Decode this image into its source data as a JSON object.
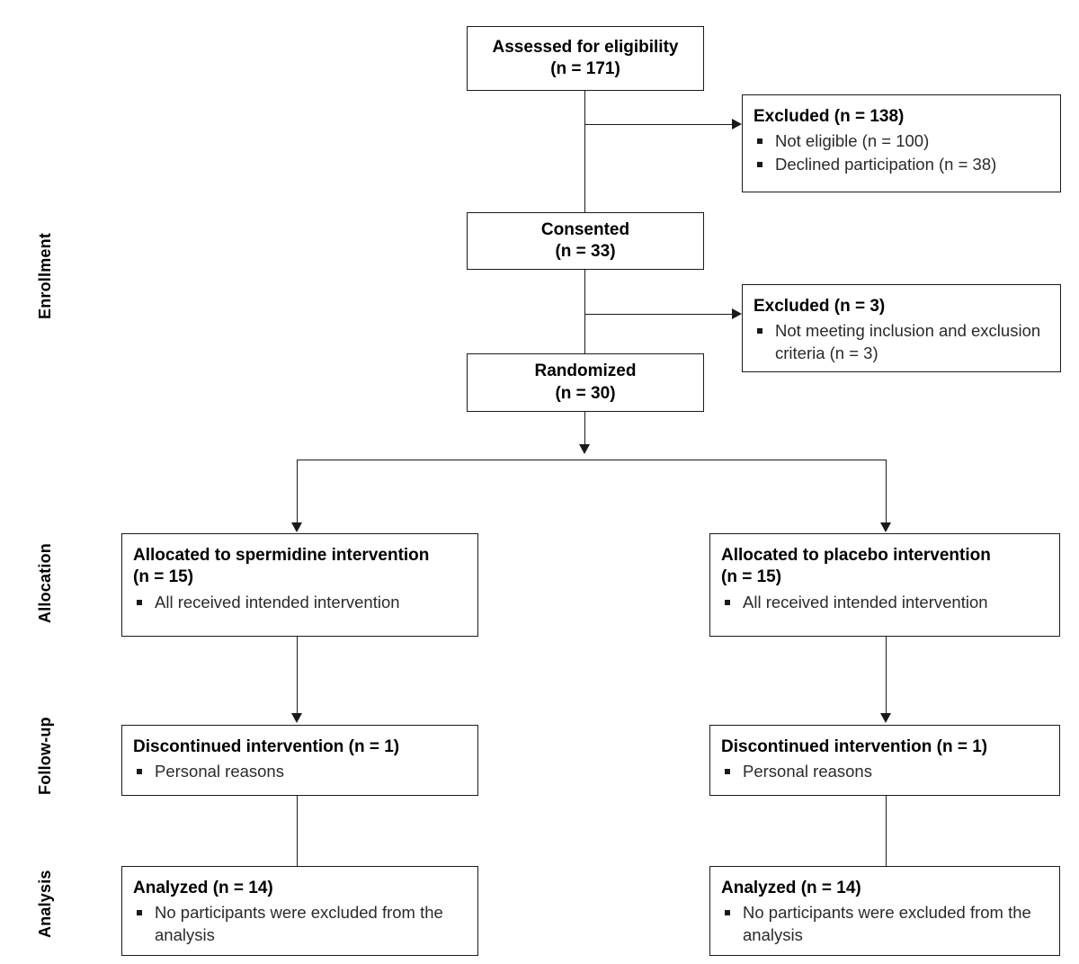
{
  "diagram": {
    "type": "CONSORT participant flow diagram",
    "stage_labels": [
      {
        "id": "enrollment",
        "text": "Enrollment"
      },
      {
        "id": "allocation",
        "text": "Allocation"
      },
      {
        "id": "follow-up",
        "text": "Follow-up"
      },
      {
        "id": "analysis",
        "text": "Analysis"
      }
    ],
    "nodes": {
      "assessed": {
        "title": "Assessed  for eligibility",
        "count_line": "(n = 171)"
      },
      "excluded_1": {
        "title": "Excluded (n = 138)",
        "bullets": [
          "Not eligible (n = 100)",
          "Declined participation (n = 38)"
        ]
      },
      "consented": {
        "title": "Consented",
        "count_line": "(n = 33)"
      },
      "excluded_2": {
        "title": "Excluded (n = 3)",
        "bullets": [
          "Not meeting inclusion and exclusion criteria (n = 3)"
        ]
      },
      "randomized": {
        "title": "Randomized",
        "count_line": "(n = 30)"
      },
      "allocated_spermidine": {
        "title": "Allocated to spermidine intervention",
        "count_line": "(n = 15)",
        "bullets": [
          "All received  intended  intervention"
        ]
      },
      "allocated_placebo": {
        "title": "Allocated to placebo intervention",
        "count_line": "(n = 15)",
        "bullets": [
          "All received  intended  intervention"
        ]
      },
      "followup_spermidine": {
        "title": "Discontinued  intervention (n = 1)",
        "bullets": [
          "Personal reasons"
        ]
      },
      "followup_placebo": {
        "title": "Discontinued  intervention (n = 1)",
        "bullets": [
          "Personal reasons"
        ]
      },
      "analysis_spermidine": {
        "title": "Analyzed (n = 14)",
        "bullets": [
          "No participants were  excluded from the analysis"
        ]
      },
      "analysis_placebo": {
        "title": "Analyzed (n = 14)",
        "bullets": [
          "No participants were  excluded from the analysis"
        ]
      }
    },
    "colors": {
      "stroke": "#1a1a1a",
      "text": "#000000",
      "background": "#ffffff"
    }
  }
}
